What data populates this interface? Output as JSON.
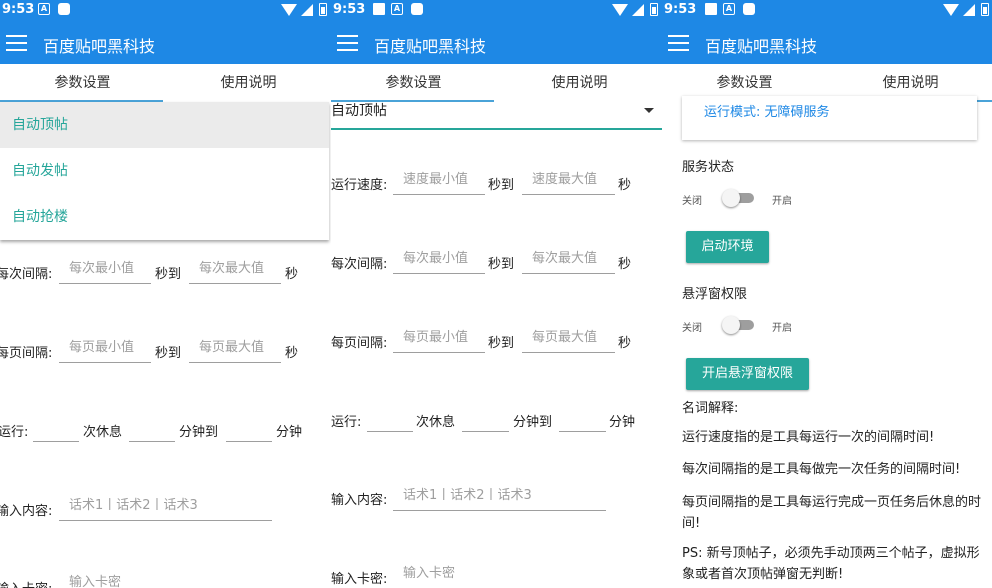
{
  "status_bar": {
    "time": "9:53"
  },
  "app": {
    "title": "百度贴吧黑科技"
  },
  "tabs": [
    "参数设置",
    "使用说明"
  ],
  "modes": [
    "自动顶帖",
    "自动发帖",
    "自动抢楼"
  ],
  "selected_mode": "自动顶帖",
  "form": {
    "speed_label": "运行速度:",
    "interval_label": "每次间隔:",
    "page_interval_label": "每页间隔:",
    "run_label": "运行:",
    "input_label": "输入内容:",
    "card_label": "输入卡密:",
    "sec_to": "秒到",
    "sec": "秒",
    "times_rest": "次休息",
    "min_to": "分钟到",
    "min": "分钟",
    "placeholders": {
      "speed_min": "速度最小值",
      "speed_max": "速度最大值",
      "each_min": "每次最小值",
      "each_max": "每次最大值",
      "page_min": "每页最小值",
      "page_max": "每页最大值",
      "content": "话术1丨话术2丨话术3",
      "card": "输入卡密"
    }
  },
  "instructions": {
    "run_mode": "运行模式: 无障碍服务",
    "service_status": "服务状态",
    "off": "关闭",
    "on": "开启",
    "start_env": "启动环境",
    "float_perm": "悬浮窗权限",
    "open_float": "开启悬浮窗权限",
    "terms_title": "名词解释:",
    "para1": "运行速度指的是工具每运行一次的间隔时间!",
    "para2": "每次间隔指的是工具每做完一次任务的间隔时间!",
    "para3": "每页间隔指的是工具每运行完成一页任务后休息的时间!",
    "para4": "PS: 新号顶帖子，必须先手动顶两三个帖子，虚拟形象或者首次顶帖弹窗无判断!"
  }
}
